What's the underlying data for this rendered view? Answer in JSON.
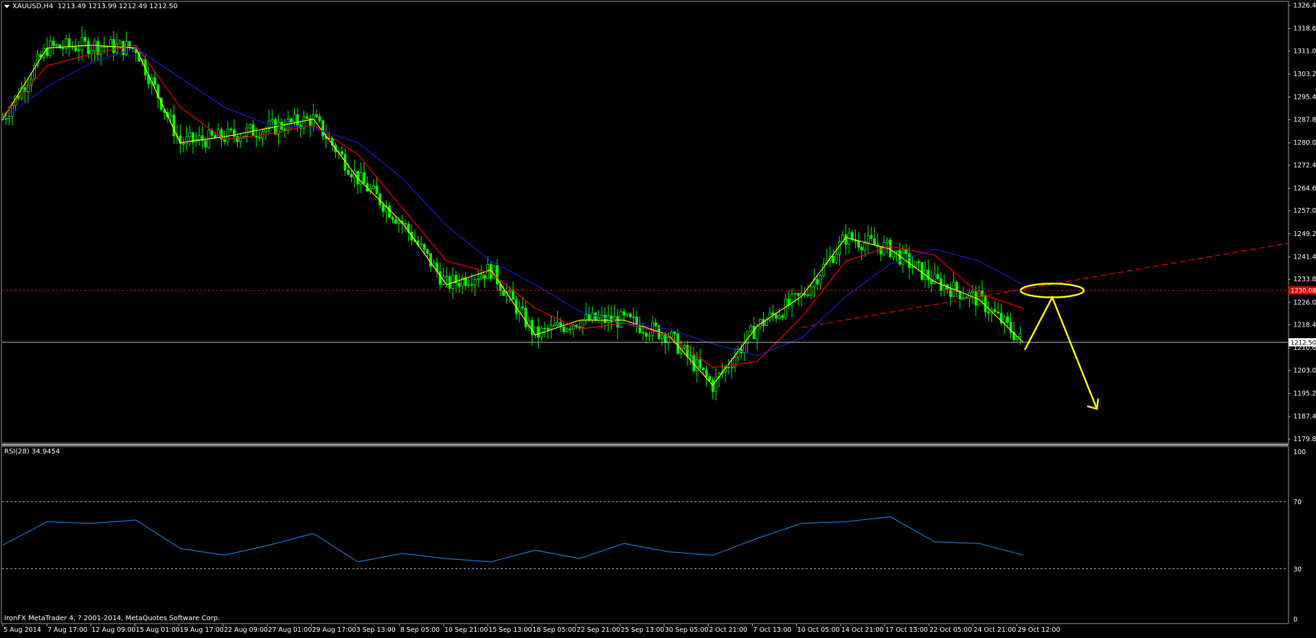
{
  "chart_header": {
    "symbol": "XAUUSD,H4",
    "ohlc": "1213.49 1213.99 1212.49 1212.50"
  },
  "rsi_header": "RSI(28) 34.9454",
  "copyright": "IronFX MetaTrader 4, ? 2001-2014, MetaQuotes Software Corp.",
  "price_axis": [
    "1326.40",
    "1318.60",
    "1311.00",
    "1303.20",
    "1295.40",
    "1287.80",
    "1280.00",
    "1272.40",
    "1264.60",
    "1257.00",
    "1249.20",
    "1241.40",
    "1233.80",
    "1226.00",
    "1218.40",
    "1210.60",
    "1203.00",
    "1195.20",
    "1187.40",
    "1179.80"
  ],
  "rsi_axis": [
    "100",
    "70",
    "30",
    "0"
  ],
  "time_axis": [
    "5 Aug 2014",
    "7 Aug 17:00",
    "12 Aug 09:00",
    "15 Aug 01:00",
    "19 Aug 17:00",
    "22 Aug 09:00",
    "27 Aug 01:00",
    "29 Aug 17:00",
    "3 Sep 13:00",
    "8 Sep 05:00",
    "10 Sep 21:00",
    "15 Sep 13:00",
    "18 Sep 05:00",
    "22 Sep 21:00",
    "25 Sep 13:00",
    "30 Sep 05:00",
    "2 Oct 21:00",
    "7 Oct 13:00",
    "10 Oct 05:00",
    "14 Oct 21:00",
    "17 Oct 13:00",
    "22 Oct 05:00",
    "24 Oct 21:00",
    "29 Oct 12:00"
  ],
  "price_labels": {
    "bid": "1212.50",
    "alert": "1230.08"
  },
  "colors": {
    "candles": "#00ff00",
    "ma_fast": "#ffff00",
    "ma_mid": "#ff0000",
    "ma_slow": "#1c1cd8",
    "rsi": "#1e90ff",
    "alert_line": "#ff0000",
    "annotation": "#ffff00"
  },
  "chart_data": {
    "type": "line",
    "symbol": "XAUUSD",
    "timeframe": "H4",
    "ylim": [
      1179.8,
      1326.4
    ],
    "x": [
      "5 Aug 2014",
      "7 Aug 17:00",
      "12 Aug 09:00",
      "15 Aug 01:00",
      "19 Aug 17:00",
      "22 Aug 09:00",
      "27 Aug 01:00",
      "29 Aug 17:00",
      "3 Sep 13:00",
      "8 Sep 05:00",
      "10 Sep 21:00",
      "15 Sep 13:00",
      "18 Sep 05:00",
      "22 Sep 21:00",
      "25 Sep 13:00",
      "30 Sep 05:00",
      "2 Oct 21:00",
      "7 Oct 13:00",
      "10 Oct 05:00",
      "14 Oct 21:00",
      "17 Oct 13:00",
      "22 Oct 05:00",
      "24 Oct 21:00",
      "29 Oct 12:00"
    ],
    "series": [
      {
        "values": [
          1288,
          1312,
          1313,
          1312,
          1280,
          1282,
          1285,
          1288,
          1268,
          1253,
          1232,
          1237,
          1215,
          1220,
          1220,
          1215,
          1198,
          1218,
          1228,
          1248,
          1244,
          1233,
          1227,
          1212.5
        ]
      },
      {
        "values": [
          1289,
          1306,
          1310,
          1313,
          1292,
          1281,
          1283,
          1286,
          1276,
          1258,
          1240,
          1236,
          1224,
          1217,
          1219,
          1215,
          1204,
          1206,
          1221,
          1240,
          1245,
          1242,
          1229,
          1224
        ]
      },
      {
        "values": [
          1288,
          1299,
          1307,
          1312,
          1302,
          1292,
          1286,
          1285,
          1280,
          1268,
          1252,
          1240,
          1232,
          1223,
          1219,
          1217,
          1212,
          1208,
          1214,
          1228,
          1239,
          1244,
          1240,
          1232
        ]
      }
    ],
    "rsi": {
      "ylim": [
        0,
        100
      ],
      "levels": [
        70,
        30
      ],
      "values": [
        44,
        58,
        57,
        59,
        42,
        38,
        44,
        51,
        34,
        39,
        36,
        34,
        41,
        36,
        45,
        40,
        38,
        48,
        57,
        58,
        61,
        46,
        45,
        38
      ]
    },
    "horizontal_lines": [
      1230.08,
      1212.5
    ],
    "trendline": {
      "from": [
        "10 Oct 05:00",
        1217.5
      ],
      "to": [
        "29 Oct 12:00",
        1230.5
      ]
    }
  }
}
